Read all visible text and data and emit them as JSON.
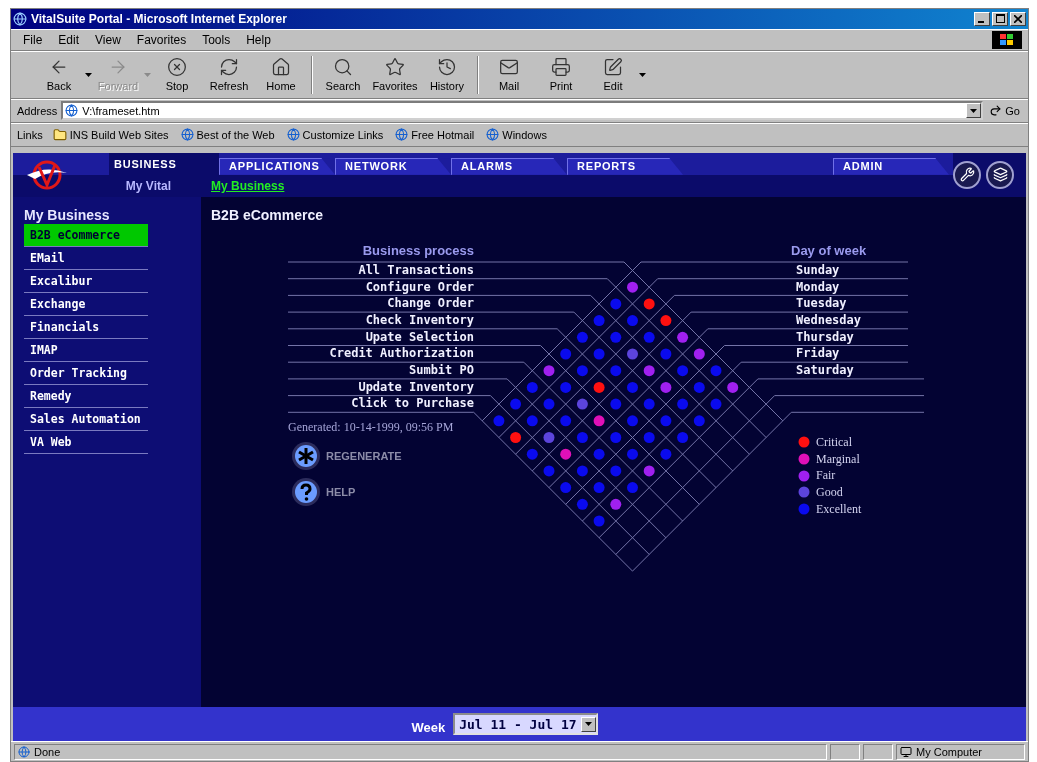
{
  "window": {
    "title": "VitalSuite Portal - Microsoft Internet Explorer"
  },
  "menu": [
    "File",
    "Edit",
    "View",
    "Favorites",
    "Tools",
    "Help"
  ],
  "toolbar_groups": [
    {
      "buttons": [
        {
          "label": "Back",
          "kind": "back",
          "disabled": false,
          "dropdown": true
        },
        {
          "label": "Forward",
          "kind": "forward",
          "disabled": true,
          "dropdown": true
        },
        {
          "label": "Stop",
          "kind": "stop",
          "disabled": false,
          "dropdown": false
        },
        {
          "label": "Refresh",
          "kind": "refresh",
          "disabled": false,
          "dropdown": false
        },
        {
          "label": "Home",
          "kind": "home",
          "disabled": false,
          "dropdown": false
        }
      ]
    },
    {
      "buttons": [
        {
          "label": "Search",
          "kind": "search",
          "disabled": false,
          "dropdown": false
        },
        {
          "label": "Favorites",
          "kind": "favorites",
          "disabled": false,
          "dropdown": false
        },
        {
          "label": "History",
          "kind": "history",
          "disabled": false,
          "dropdown": false
        }
      ]
    },
    {
      "buttons": [
        {
          "label": "Mail",
          "kind": "mail",
          "disabled": false,
          "dropdown": false
        },
        {
          "label": "Print",
          "kind": "print",
          "disabled": false,
          "dropdown": false
        },
        {
          "label": "Edit",
          "kind": "edit",
          "disabled": false,
          "dropdown": true
        }
      ]
    }
  ],
  "address": {
    "label": "Address",
    "value": "V:\\frameset.htm",
    "go": "Go"
  },
  "links": {
    "label": "Links",
    "items": [
      {
        "label": "INS Build Web Sites",
        "kind": "folder"
      },
      {
        "label": "Best of the Web",
        "kind": "page"
      },
      {
        "label": "Customize Links",
        "kind": "page"
      },
      {
        "label": "Free Hotmail",
        "kind": "page"
      },
      {
        "label": "Windows",
        "kind": "page"
      }
    ]
  },
  "nav": {
    "tabs": [
      {
        "label": "BUSINESS",
        "selected": true
      },
      {
        "label": "APPLICATIONS",
        "selected": false
      },
      {
        "label": "NETWORK",
        "selected": false
      },
      {
        "label": "ALARMS",
        "selected": false
      },
      {
        "label": "REPORTS",
        "selected": false
      },
      {
        "label": "ADMIN",
        "selected": false
      }
    ],
    "subnav": [
      {
        "label": "My Vital",
        "selected": false
      },
      {
        "label": "My Business",
        "selected": true
      }
    ]
  },
  "sidebar": {
    "title": "My Business",
    "items": [
      {
        "label": "B2B eCommerce",
        "selected": true
      },
      {
        "label": "EMail",
        "selected": false
      },
      {
        "label": "Excalibur",
        "selected": false
      },
      {
        "label": "Exchange",
        "selected": false
      },
      {
        "label": "Financials",
        "selected": false
      },
      {
        "label": "IMAP",
        "selected": false
      },
      {
        "label": "Order Tracking",
        "selected": false
      },
      {
        "label": "Remedy",
        "selected": false
      },
      {
        "label": "Sales Automation",
        "selected": false
      },
      {
        "label": "VA Web",
        "selected": false
      }
    ]
  },
  "main": {
    "title": "B2B eCommerce",
    "process_header": "Business process",
    "day_header": "Day of week",
    "processes": [
      {
        "name": "All Transactions",
        "cells": [
          {
            "color": "#a020f0"
          },
          {
            "color": "#ff1010"
          },
          {
            "color": "#ff1010"
          },
          {
            "color": "#a020f0"
          },
          {
            "color": "#a020f0"
          },
          {
            "color": "#0a0aee"
          },
          {
            "color": "#a020f0"
          }
        ]
      },
      {
        "name": "Configure Order",
        "cells": [
          {
            "color": "#0a0aee"
          },
          {
            "color": "#0a0aee"
          },
          {
            "color": "#0a0aee"
          },
          {
            "color": "#0a0aee"
          },
          {
            "color": "#0a0aee"
          },
          {
            "color": "#0a0aee"
          },
          {
            "color": "#0a0aee"
          }
        ]
      },
      {
        "name": "Change Order",
        "cells": [
          {
            "color": "#0a0aee"
          },
          {
            "color": "#0a0aee"
          },
          {
            "color": "#5c44dc"
          },
          {
            "color": "#a020f0"
          },
          {
            "color": "#a020f0"
          },
          {
            "color": "#0a0aee"
          },
          {
            "color": "#0a0aee"
          }
        ]
      },
      {
        "name": "Check Inventory",
        "cells": [
          {
            "color": "#0a0aee"
          },
          {
            "color": "#0a0aee"
          },
          {
            "color": "#0a0aee"
          },
          {
            "color": "#0a0aee"
          },
          {
            "color": "#0a0aee"
          },
          {
            "color": "#0a0aee"
          },
          {
            "color": "#0a0aee"
          }
        ]
      },
      {
        "name": "Upate Selection",
        "cells": [
          {
            "color": "#0a0aee"
          },
          {
            "color": "#0a0aee"
          },
          {
            "color": "#ff1010"
          },
          {
            "color": "#0a0aee"
          },
          {
            "color": "#0a0aee"
          },
          {
            "color": "#0a0aee"
          },
          {
            "color": "#0a0aee"
          }
        ]
      },
      {
        "name": "Credit Authorization",
        "cells": [
          {
            "color": "#a020f0"
          },
          {
            "color": "#0a0aee"
          },
          {
            "color": "#5c44dc"
          },
          {
            "color": "#e010b8"
          },
          {
            "color": "#0a0aee"
          },
          {
            "color": "#0a0aee"
          },
          {
            "color": "#a020f0"
          }
        ]
      },
      {
        "name": "Sumbit PO",
        "cells": [
          {
            "color": "#0a0aee"
          },
          {
            "color": "#0a0aee"
          },
          {
            "color": "#0a0aee"
          },
          {
            "color": "#0a0aee"
          },
          {
            "color": "#0a0aee"
          },
          {
            "color": "#0a0aee"
          },
          {
            "color": "#0a0aee"
          }
        ]
      },
      {
        "name": "Update Inventory",
        "cells": [
          {
            "color": "#0a0aee"
          },
          {
            "color": "#0a0aee"
          },
          {
            "color": "#5c44dc"
          },
          {
            "color": "#e010b8"
          },
          {
            "color": "#0a0aee"
          },
          {
            "color": "#0a0aee"
          },
          {
            "color": "#a020f0"
          }
        ]
      },
      {
        "name": "Click to Purchase",
        "cells": [
          {
            "color": "#0a0aee"
          },
          {
            "color": "#ff1010"
          },
          {
            "color": "#0a0aee"
          },
          {
            "color": "#0a0aee"
          },
          {
            "color": "#0a0aee"
          },
          {
            "color": "#0a0aee"
          },
          {
            "color": "#0a0aee"
          }
        ]
      }
    ],
    "days": [
      "Sunday",
      "Monday",
      "Tuesday",
      "Wednesday",
      "Thursday",
      "Friday",
      "Saturday"
    ],
    "generated": "Generated: 10-14-1999, 09:56 PM",
    "actions": [
      {
        "label": "REGENERATE",
        "kind": "regenerate"
      },
      {
        "label": "HELP",
        "kind": "help"
      }
    ],
    "legend": [
      {
        "label": "Critical",
        "color": "#ff1010"
      },
      {
        "label": "Marginal",
        "color": "#e010b8"
      },
      {
        "label": "Fair",
        "color": "#a020f0"
      },
      {
        "label": "Good",
        "color": "#5c44dc"
      },
      {
        "label": "Excellent",
        "color": "#0a0aee"
      }
    ]
  },
  "week": {
    "label": "Week",
    "value": "Jul 11 - Jul 17"
  },
  "status_bar": {
    "text": "Done",
    "zone": "My Computer"
  }
}
